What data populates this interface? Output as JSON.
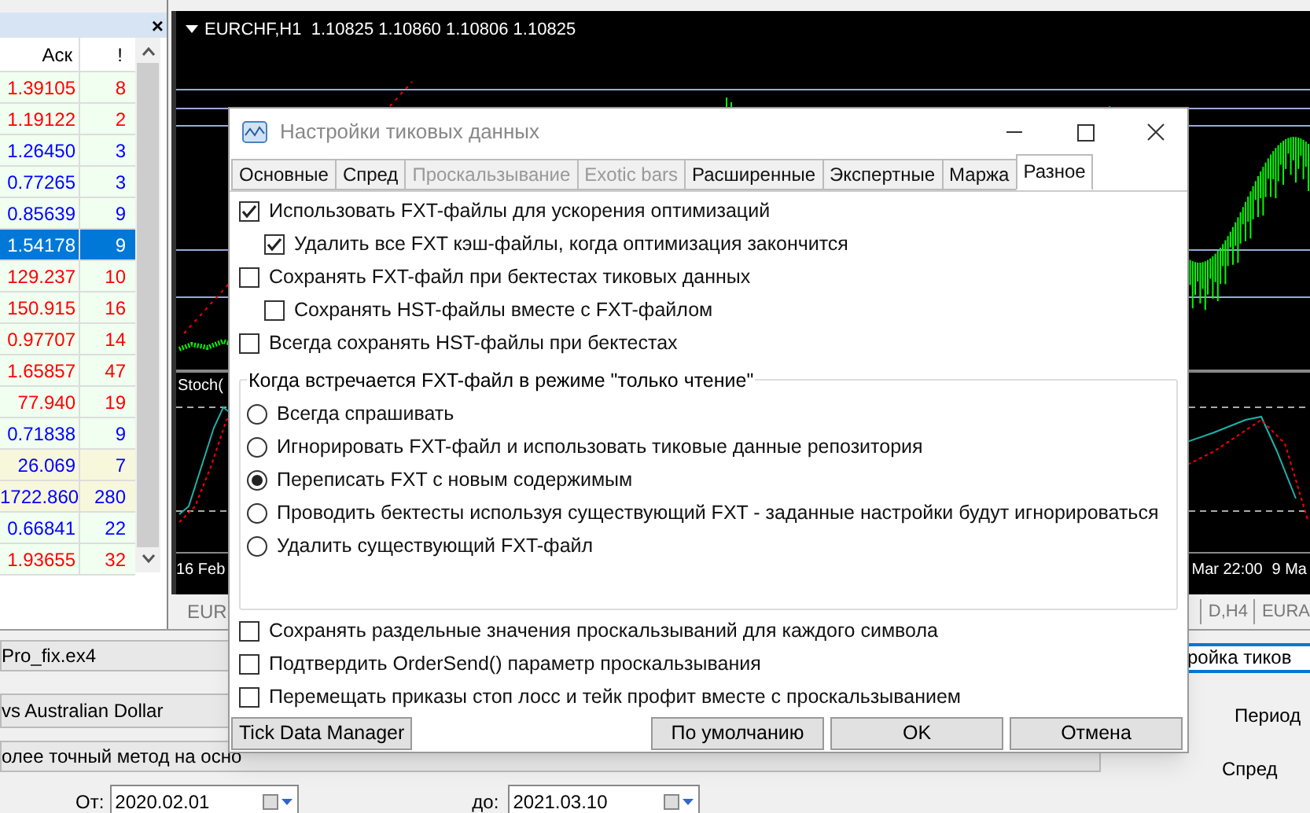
{
  "market_watch": {
    "columns": [
      "Аск",
      "!"
    ],
    "close": "×",
    "rows": [
      {
        "ask": "1.39105",
        "spread": "8",
        "color": "#ff0000",
        "selected": false,
        "kind": "plain"
      },
      {
        "ask": "1.19122",
        "spread": "2",
        "color": "#ff0000",
        "selected": false,
        "kind": "plain"
      },
      {
        "ask": "1.26450",
        "spread": "3",
        "color": "#0000ff",
        "selected": false,
        "kind": "plain"
      },
      {
        "ask": "0.77265",
        "spread": "3",
        "color": "#0000ff",
        "selected": false,
        "kind": "plain"
      },
      {
        "ask": "0.85639",
        "spread": "9",
        "color": "#0000ff",
        "selected": false,
        "kind": "plain"
      },
      {
        "ask": "1.54178",
        "spread": "9",
        "selected": true
      },
      {
        "ask": "129.237",
        "spread": "10",
        "color": "#ff0000",
        "selected": false,
        "kind": "plain"
      },
      {
        "ask": "150.915",
        "spread": "16",
        "color": "#ff0000",
        "selected": false,
        "kind": "plain"
      },
      {
        "ask": "0.97707",
        "spread": "14",
        "color": "#ff0000",
        "selected": false,
        "kind": "plain"
      },
      {
        "ask": "1.65857",
        "spread": "47",
        "color": "#ff0000",
        "selected": false,
        "kind": "plain"
      },
      {
        "ask": "77.940",
        "spread": "19",
        "color": "#ff0000",
        "selected": false,
        "kind": "plain"
      },
      {
        "ask": "0.71838",
        "spread": "9",
        "color": "#0000ff",
        "selected": false,
        "kind": "plain"
      },
      {
        "ask": "26.069",
        "spread": "7",
        "color": "#0000ff",
        "selected": false,
        "kind": "marked"
      },
      {
        "ask": "1722.860",
        "spread": "280",
        "color": "#0000ff",
        "selected": false,
        "kind": "marked"
      },
      {
        "ask": "0.66841",
        "spread": "22",
        "color": "#0000ff",
        "selected": false,
        "kind": "plain"
      },
      {
        "ask": "1.93655",
        "spread": "32",
        "color": "#ff0000",
        "selected": false,
        "kind": "plain"
      }
    ]
  },
  "chart": {
    "title": "EURCHF,H1  1.10825 1.10860 1.10806 1.10825",
    "indicator": "Stoch(",
    "time_labels": [
      "16 Feb",
      "Mar 22:00",
      "9 Ma"
    ],
    "tabs": [
      {
        "label": "EUR",
        "selected": false
      },
      {
        "label": "D,H4",
        "selected": false
      },
      {
        "label": "EURA",
        "selected": false
      }
    ]
  },
  "tester": {
    "expert": "Pro_fix.ex4",
    "symbol": "vs Australian Dollar",
    "model_text": "олее точный метод на осно",
    "from_label": "От:",
    "from": "2020.02.01",
    "to_label": "до:",
    "to": "2021.03.10",
    "side_tab": "ройка тиков",
    "side_labels": [
      "Период",
      "Спред"
    ]
  },
  "dialog": {
    "title": "Настройки тиковых данных",
    "tabs": [
      {
        "label": "Основные",
        "selected": false,
        "disabled": false
      },
      {
        "label": "Спред",
        "selected": false,
        "disabled": false
      },
      {
        "label": "Проскальзывание",
        "selected": false,
        "disabled": true
      },
      {
        "label": "Exotic bars",
        "selected": false,
        "disabled": true
      },
      {
        "label": "Расширенные",
        "selected": false,
        "disabled": false
      },
      {
        "label": "Экспертные",
        "selected": false,
        "disabled": false
      },
      {
        "label": "Маржа",
        "selected": false,
        "disabled": false
      },
      {
        "label": "Разное",
        "selected": true,
        "disabled": false
      }
    ],
    "options": [
      {
        "label": "Использовать FXT-файлы для ускорения оптимизаций",
        "checked": true,
        "children": [
          {
            "label": "Удалить все FXT кэш-файлы, когда оптимизация закончится",
            "checked": true
          }
        ]
      },
      {
        "label": "Сохранять FXT-файл при бектестах тиковых данных",
        "checked": false,
        "children": [
          {
            "label": "Сохранять HST-файлы вместе с FXT-файлом",
            "checked": false
          }
        ]
      },
      {
        "label": "Всегда сохранять HST-файлы при бектестах",
        "checked": false
      }
    ],
    "group": {
      "title": "Когда встречается FXT-файл в режиме \"только чтение\"",
      "radios": [
        {
          "label": "Всегда спрашивать",
          "selected": false
        },
        {
          "label": "Игнорировать FXT-файл и использовать тиковые данные репозитория",
          "selected": false
        },
        {
          "label": "Переписать FXT с новым содержимым",
          "selected": true
        },
        {
          "label": "Проводить бектесты используя существующий FXT - заданные настройки будут игнорироваться",
          "selected": false
        },
        {
          "label": "Удалить существующий FXT-файл",
          "selected": false
        }
      ]
    },
    "more_options": [
      {
        "label": "Сохранять раздельные значения проскальзываний для каждого символа",
        "checked": false
      },
      {
        "label": "Подтвердить OrderSend() параметр проскальзывания",
        "checked": false
      },
      {
        "label": "Перемещать приказы стоп лосс и тейк профит вместе с проскальзыванием",
        "checked": false
      }
    ],
    "buttons": [
      "Tick Data Manager",
      "По умолчанию",
      "OK",
      "Отмена"
    ]
  }
}
